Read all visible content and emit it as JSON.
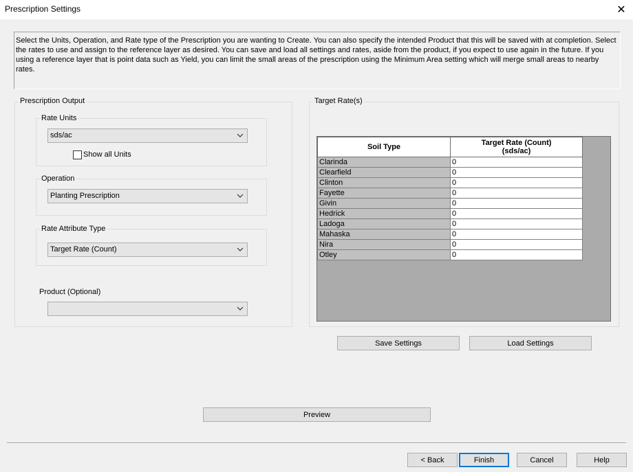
{
  "window": {
    "title": "Prescription Settings",
    "close_symbol": "✕"
  },
  "description": "Select the Units, Operation, and Rate type of the Prescription you are wanting to Create. You can also specify the intended Product that this will be saved with at completion. Select the rates to use and assign to the reference layer as desired.  You can save and load all settings and rates, aside from the product, if you expect to use again in the future. If you using a reference layer that is point data such as Yield, you can limit the small areas of the prescription using the Minimum Area setting which will merge small areas to nearby rates.",
  "output": {
    "group_label": "Prescription Output",
    "rate_units": {
      "label": "Rate Units",
      "value": "sds/ac",
      "show_all_label": "Show all Units",
      "show_all_checked": false
    },
    "operation": {
      "label": "Operation",
      "value": "Planting Prescription"
    },
    "rate_attribute": {
      "label": "Rate Attribute Type",
      "value": "Target Rate (Count)"
    },
    "product": {
      "label": "Product (Optional)",
      "value": ""
    }
  },
  "target_rates": {
    "group_label": "Target Rate(s)",
    "columns": [
      "Soil Type",
      "Target Rate (Count)",
      "(sds/ac)"
    ],
    "rows": [
      {
        "soil": "Clarinda",
        "rate": "0"
      },
      {
        "soil": "Clearfield",
        "rate": "0"
      },
      {
        "soil": "Clinton",
        "rate": "0"
      },
      {
        "soil": "Fayette",
        "rate": "0"
      },
      {
        "soil": "Givin",
        "rate": "0"
      },
      {
        "soil": "Hedrick",
        "rate": "0"
      },
      {
        "soil": "Ladoga",
        "rate": "0"
      },
      {
        "soil": "Mahaska",
        "rate": "0"
      },
      {
        "soil": "Nira",
        "rate": "0"
      },
      {
        "soil": "Otley",
        "rate": "0"
      }
    ],
    "save_label": "Save Settings",
    "load_label": "Load Settings"
  },
  "preview_label": "Preview",
  "footer": {
    "back_label": "< Back",
    "finish_label": "Finish",
    "cancel_label": "Cancel",
    "help_label": "Help"
  },
  "icons": {
    "close": "close-icon",
    "dropdown": "chevron-down-icon"
  }
}
